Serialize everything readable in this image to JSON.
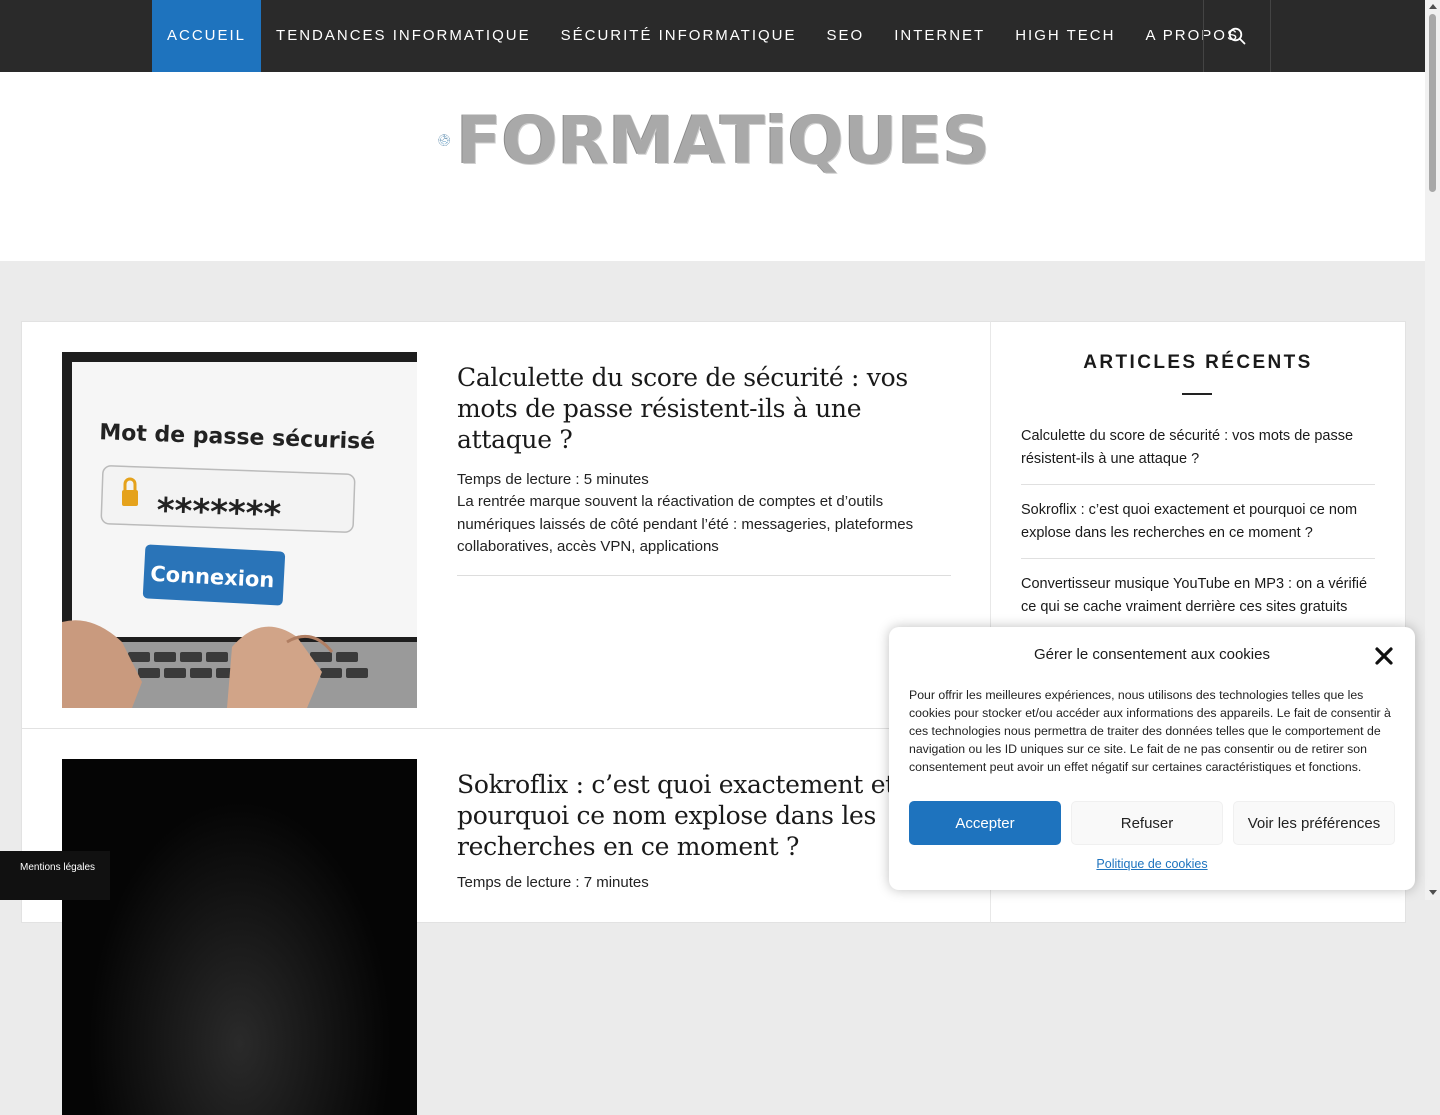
{
  "nav": {
    "items": [
      {
        "label": "ACCUEIL",
        "active": true
      },
      {
        "label": "TENDANCES INFORMATIQUE",
        "active": false
      },
      {
        "label": "SÉCURITÉ INFORMATIQUE",
        "active": false
      },
      {
        "label": "SEO",
        "active": false
      },
      {
        "label": "INTERNET",
        "active": false
      },
      {
        "label": "HIGH TECH",
        "active": false
      },
      {
        "label": "A PROPOS",
        "active": false
      }
    ],
    "search_icon": "search-icon"
  },
  "site": {
    "logo_text": "FORMATiQUES",
    "logo_icon": "circuit-globe-icon"
  },
  "posts": [
    {
      "title": "Calculette du score de sécurité : vos mots de passe résistent-ils à une attaque ?",
      "read_time": "Temps de lecture : 5 minutes",
      "excerpt": "La rentrée marque souvent la réactivation de comptes et d’outils numériques laissés de côté pendant l’été : messageries, plateformes collaboratives, accès VPN, applications",
      "image": {
        "heading": "Mot de passe sécurisé",
        "password_mask": "*******",
        "button": "Connexion"
      }
    },
    {
      "title": "Sokroflix : c’est quoi exactement et pourquoi ce nom explose dans les recherches en ce moment ?",
      "read_time": "Temps de lecture : 7 minutes",
      "excerpt": "",
      "image": {}
    }
  ],
  "sidebar": {
    "title": "ARTICLES RÉCENTS",
    "recent": [
      "Calculette du score de sécurité : vos mots de passe résistent-ils à une attaque ?",
      "Sokroflix : c’est quoi exactement et pourquoi ce nom explose dans les recherches en ce moment ?",
      "Convertisseur musique YouTube en MP3 : on a vérifié ce qui se cache vraiment derrière ces sites gratuits"
    ]
  },
  "legal": {
    "label": "Mentions légales"
  },
  "cookie": {
    "title": "Gérer le consentement aux cookies",
    "text": "Pour offrir les meilleures expériences, nous utilisons des technologies telles que les cookies pour stocker et/ou accéder aux informations des appareils. Le fait de consentir à ces technologies nous permettra de traiter des données telles que le comportement de navigation ou les ID uniques sur ce site. Le fait de ne pas consentir ou de retirer son consentement peut avoir un effet négatif sur certaines caractéristiques et fonctions.",
    "accept": "Accepter",
    "refuse": "Refuser",
    "preferences": "Voir les préférences",
    "policy": "Politique de cookies",
    "close_icon": "close-icon"
  },
  "colors": {
    "accent": "#1e73be",
    "nav_bg": "#2a2a2a",
    "page_bg": "#ebebeb"
  }
}
